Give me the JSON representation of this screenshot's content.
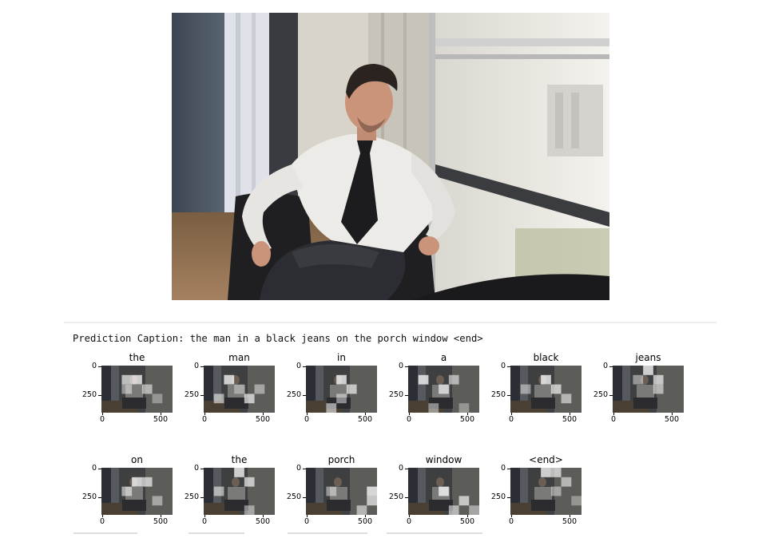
{
  "photo": {
    "icon": "man-in-chair-photo",
    "colors": {
      "wall": "#4a5561",
      "window": "#e4e2dc",
      "shirt": "#ecebe8",
      "tie": "#1c1c1f",
      "trousers": "#2c2d33",
      "chair": "#1a1a1d",
      "floor": "#8a6a4a"
    }
  },
  "output": {
    "caption": "Prediction Caption: the man in a black jeans on the porch window <end>",
    "tick_labels": {
      "y_top": "0",
      "y_mid": "250",
      "x_left": "0",
      "x_right": "500"
    },
    "words": [
      {
        "word": "the"
      },
      {
        "word": "man"
      },
      {
        "word": "in"
      },
      {
        "word": "a"
      },
      {
        "word": "black"
      },
      {
        "word": "jeans"
      },
      {
        "word": "on"
      },
      {
        "word": "the"
      },
      {
        "word": "porch"
      },
      {
        "word": "window"
      },
      {
        "word": "<end>"
      }
    ]
  }
}
